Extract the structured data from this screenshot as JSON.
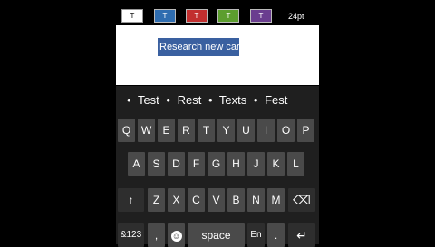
{
  "toolbar": {
    "swatches": [
      {
        "label": "T",
        "color": "#ffffff"
      },
      {
        "label": "T",
        "color": "#2f6db0"
      },
      {
        "label": "T",
        "color": "#c22f2f"
      },
      {
        "label": "T",
        "color": "#5c9e2e"
      },
      {
        "label": "T",
        "color": "#6a3d8f"
      }
    ],
    "font_size": "24pt"
  },
  "document": {
    "selected_text": "Research new car"
  },
  "suggestions": [
    "Test",
    "Rest",
    "Texts",
    "Fest"
  ],
  "suggestion_bullet": "•",
  "keyboard": {
    "row1": [
      "Q",
      "W",
      "E",
      "R",
      "T",
      "Y",
      "U",
      "I",
      "O",
      "P"
    ],
    "row2": [
      "A",
      "S",
      "D",
      "F",
      "G",
      "H",
      "J",
      "K",
      "L"
    ],
    "row3": [
      "Z",
      "X",
      "C",
      "V",
      "B",
      "N",
      "M"
    ],
    "shift_icon": "↑",
    "backspace_icon": "⌫",
    "symbols_label": "&123",
    "comma_label": ",",
    "emoji_icon": "☺",
    "space_label": "space",
    "language_label": "En",
    "period_label": ".",
    "enter_icon": "↵"
  }
}
